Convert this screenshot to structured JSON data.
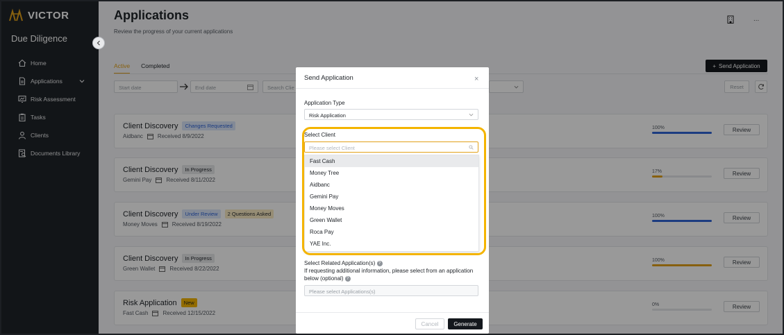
{
  "sidebar": {
    "logo_text": "VICTOR",
    "title": "Due Diligence",
    "items": [
      {
        "label": "Home",
        "icon": "home-icon"
      },
      {
        "label": "Applications",
        "icon": "document-icon"
      },
      {
        "label": "Risk Assessment",
        "icon": "chart-icon"
      },
      {
        "label": "Tasks",
        "icon": "clipboard-icon"
      },
      {
        "label": "Clients",
        "icon": "user-icon"
      },
      {
        "label": "Documents Library",
        "icon": "library-icon"
      }
    ]
  },
  "header": {
    "title": "Applications",
    "subtitle": "Review the progress of your current applications",
    "more": "..."
  },
  "tabs": {
    "active": "Active",
    "completed": "Completed"
  },
  "toolbar": {
    "send_application": "Send Application",
    "start_date": "Start date",
    "end_date": "End date",
    "search_placeholder": "Search Clie",
    "reset": "Reset"
  },
  "applications": [
    {
      "title": "Client Discovery",
      "badges": [
        "Changes Requested"
      ],
      "client": "Aidbanc",
      "received": "Received 8/9/2022",
      "progress": "100%"
    },
    {
      "title": "Client Discovery",
      "badges": [
        "In Progress"
      ],
      "client": "Gemini Pay",
      "received": "Received 8/11/2022",
      "progress": "17%"
    },
    {
      "title": "Client Discovery",
      "badges": [
        "Under Review",
        "2 Questions Asked"
      ],
      "client": "Money Moves",
      "received": "Received 8/19/2022",
      "progress": "100%"
    },
    {
      "title": "Client Discovery",
      "badges": [
        "In Progress"
      ],
      "client": "Green Wallet",
      "received": "Received 8/22/2022",
      "progress": "100%"
    },
    {
      "title": "Risk Application",
      "badges": [
        "New"
      ],
      "client": "Fast Cash",
      "received": "Received 12/15/2022",
      "progress": "0%"
    }
  ],
  "review_label": "Review",
  "colors": {
    "accent": "#e2a11a",
    "blue": "#2f64d6",
    "highlight": "#f4b400"
  },
  "modal": {
    "title": "Send Application",
    "close": "×",
    "app_type_label": "Application Type",
    "app_type_value": "Risk Application",
    "select_client_label": "Select Client",
    "client_placeholder": "Please select Client",
    "client_options": [
      "Fast Cash",
      "Money Tree",
      "Aidbanc",
      "Gemini Pay",
      "Money Moves",
      "Green Wallet",
      "Roca Pay",
      "YAE Inc."
    ],
    "related_label": "Select Related Application(s)",
    "related_help": "If requesting additional information, please select from an application below (optional)",
    "related_placeholder": "Please select Applications(s)",
    "cancel": "Cancel",
    "generate": "Generate"
  }
}
